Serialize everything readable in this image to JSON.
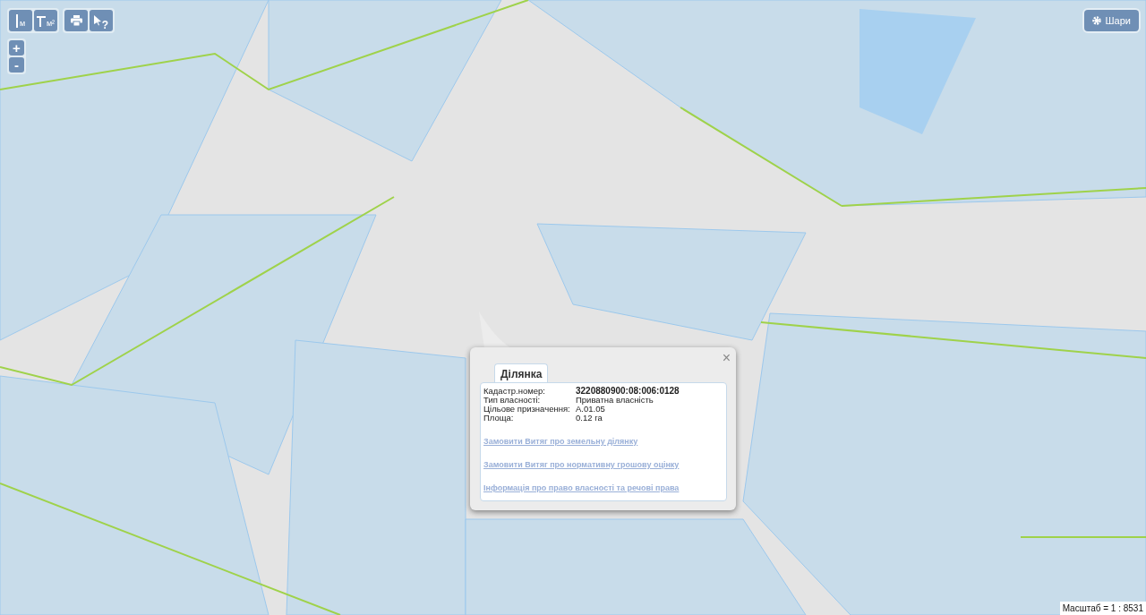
{
  "toolbar": [
    {
      "kind": "length",
      "label": "м"
    },
    {
      "kind": "area",
      "label": "м²"
    },
    {
      "kind": "print"
    },
    {
      "kind": "identify",
      "label": "?"
    }
  ],
  "zoom": [
    {
      "label": "+"
    },
    {
      "label": "-"
    }
  ],
  "layers_button": {
    "label": "Шари"
  },
  "popup": {
    "close": "×",
    "tabs": [
      {
        "label": "Ділянка",
        "selected": true
      }
    ],
    "fields": [
      {
        "label": "Кадастр.номер:",
        "value": "3220880900:08:006:0128",
        "bold": true
      },
      {
        "label": "Тип власності:",
        "value": "Приватна власність",
        "bold": false
      },
      {
        "label": "Цільове призначення:",
        "value": "A.01.05",
        "bold": false
      },
      {
        "label": "Площа:",
        "value": "0.12 га",
        "bold": false
      }
    ],
    "links": [
      "Замовити Витяг про земельну ділянку",
      "Замовити Витяг про нормативну грошову оцінку",
      "Інформація про право власності та речові права"
    ]
  },
  "scale": "Масштаб = 1 : 8531"
}
